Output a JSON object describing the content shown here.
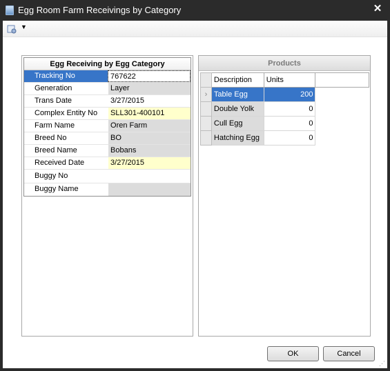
{
  "window": {
    "title": "Egg Room Farm Receivings by Category"
  },
  "left_panel": {
    "header": "Egg Receiving by Egg Category",
    "rows": [
      {
        "label": "Tracking No",
        "value": "767622"
      },
      {
        "label": "Generation",
        "value": "Layer"
      },
      {
        "label": "Trans Date",
        "value": "3/27/2015"
      },
      {
        "label": "Complex Entity No",
        "value": "SLL301-400101"
      },
      {
        "label": "Farm Name",
        "value": "Oren Farm"
      },
      {
        "label": "Breed No",
        "value": "BO"
      },
      {
        "label": "Breed Name",
        "value": "Bobans"
      },
      {
        "label": "Received Date",
        "value": "3/27/2015"
      },
      {
        "label": "Buggy No",
        "value": ""
      },
      {
        "label": "Buggy Name",
        "value": ""
      }
    ]
  },
  "products": {
    "title": "Products",
    "columns": {
      "description": "Description",
      "units": "Units"
    },
    "rows": [
      {
        "description": "Table Egg",
        "units": "200"
      },
      {
        "description": "Double Yolk",
        "units": "0"
      },
      {
        "description": "Cull Egg",
        "units": "0"
      },
      {
        "description": "Hatching Egg",
        "units": "0"
      }
    ],
    "row_indicator": "›"
  },
  "buttons": {
    "ok": "OK",
    "cancel": "Cancel"
  },
  "colors": {
    "selection": "#3775c8",
    "highlight_field": "#ffffcc",
    "readonly_field": "#dcdcdc"
  }
}
